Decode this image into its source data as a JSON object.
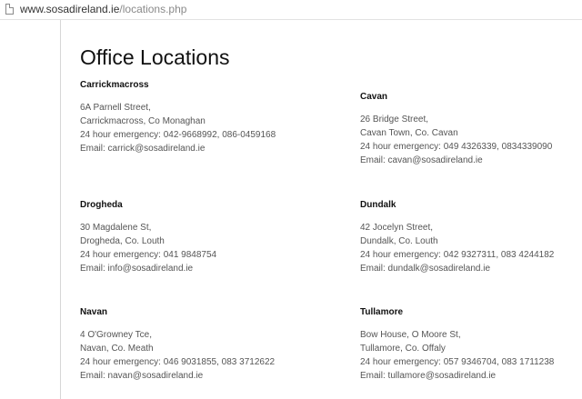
{
  "browser": {
    "url_host": "www.sosadireland.ie",
    "url_path": "/locations.php"
  },
  "page": {
    "title": "Office Locations"
  },
  "offices": [
    {
      "name": "Carrickmacross",
      "address1": "6A Parnell Street,",
      "address2": "Carrickmacross, Co Monaghan",
      "phone": "24 hour emergency: 042-9668992, 086-0459168",
      "email": "Email: carrick@sosadireland.ie"
    },
    {
      "name": "Cavan",
      "address1": "26 Bridge Street,",
      "address2": "Cavan Town, Co. Cavan",
      "phone": "24 hour emergency: 049 4326339, 0834339090",
      "email": "Email: cavan@sosadireland.ie"
    },
    {
      "name": "Drogheda",
      "address1": "30 Magdalene St,",
      "address2": "Drogheda, Co. Louth",
      "phone": "24 hour emergency: 041 9848754",
      "email": "Email: info@sosadireland.ie"
    },
    {
      "name": "Dundalk",
      "address1": "42 Jocelyn Street,",
      "address2": "Dundalk, Co. Louth",
      "phone": "24 hour emergency: 042 9327311, 083 4244182",
      "email": "Email: dundalk@sosadireland.ie"
    },
    {
      "name": "Navan",
      "address1": "4 O'Growney Tce,",
      "address2": "Navan, Co. Meath",
      "phone": "24 hour emergency: 046 9031855, 083 3712622",
      "email": "Email: navan@sosadireland.ie"
    },
    {
      "name": "Tullamore",
      "address1": "Bow House, O Moore St,",
      "address2": "Tullamore, Co. Offaly",
      "phone": "24 hour emergency: 057 9346704, 083 1711238",
      "email": "Email: tullamore@sosadireland.ie"
    }
  ]
}
